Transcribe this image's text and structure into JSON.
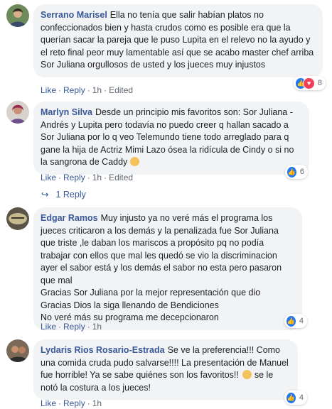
{
  "comments": [
    {
      "author": "Serrano Marisel",
      "text": "Ella no tenía que salir habían platos no confeccionados bien y hasta crudos como es posible era que la querían sacar la pareja que le puso Lupita en el relevo no la ayudo y el reto final peor muy lamentable así que se acabo master chef arriba Sor Juliana orgullosos de usted y los jueces muy injustos",
      "like_label": "Like",
      "reply_label": "Reply",
      "time": "1h",
      "edited_label": "Edited",
      "reaction_count": "8"
    },
    {
      "author": "Marlyn Silva",
      "text": "Desde un principio mis favoritos son: Sor Juliana -Andrés y Lupita pero todavía no puedo creer q hallan sacado a Sor Juliana por lo q veo Telemundo tiene todo arreglado para q gane la hija de Actriz Mimi Lazo ósea la ridícula de Cindy o si no la sangrona de Caddy",
      "like_label": "Like",
      "reply_label": "Reply",
      "time": "1h",
      "edited_label": "Edited",
      "reaction_count": "6",
      "replies_label": "1 Reply"
    },
    {
      "author": "Edgar Ramos",
      "text": "Muy injusto ya no veré más el programa los jueces criticaron a los demás y la penalizada fue Sor Juliana que triste ,le daban los mariscos a propósito pq no podía trabajar con ellos que mal les quedó se vio la discriminacion ayer el sabor está y los demás el sabor no esta pero pasaron que mal\nGracias Sor Juliana por la mejor representación que dio\nGracias Dios la siga llenando de Bendiciones\nNo veré más su programa me decepcionaron",
      "like_label": "Like",
      "reply_label": "Reply",
      "time": "1h",
      "reaction_count": "4"
    },
    {
      "author": "Lydaris Rios Rosario-Estrada",
      "text": "Se ve la preferencia!!! Como una comida cruda pudo salvarse!!!! La presentación de Manuel fue horrible! Ya se sabe quiénes son los favoritos!!",
      "text_after_emoji": " se le notó la costura a los jueces!",
      "like_label": "Like",
      "reply_label": "Reply",
      "time": "1h",
      "reaction_count": "4"
    }
  ],
  "colors": {
    "link": "#385898",
    "bubble": "#f2f3f5",
    "meta": "#606770",
    "like": "#2078f4",
    "love": "#f33e58"
  }
}
